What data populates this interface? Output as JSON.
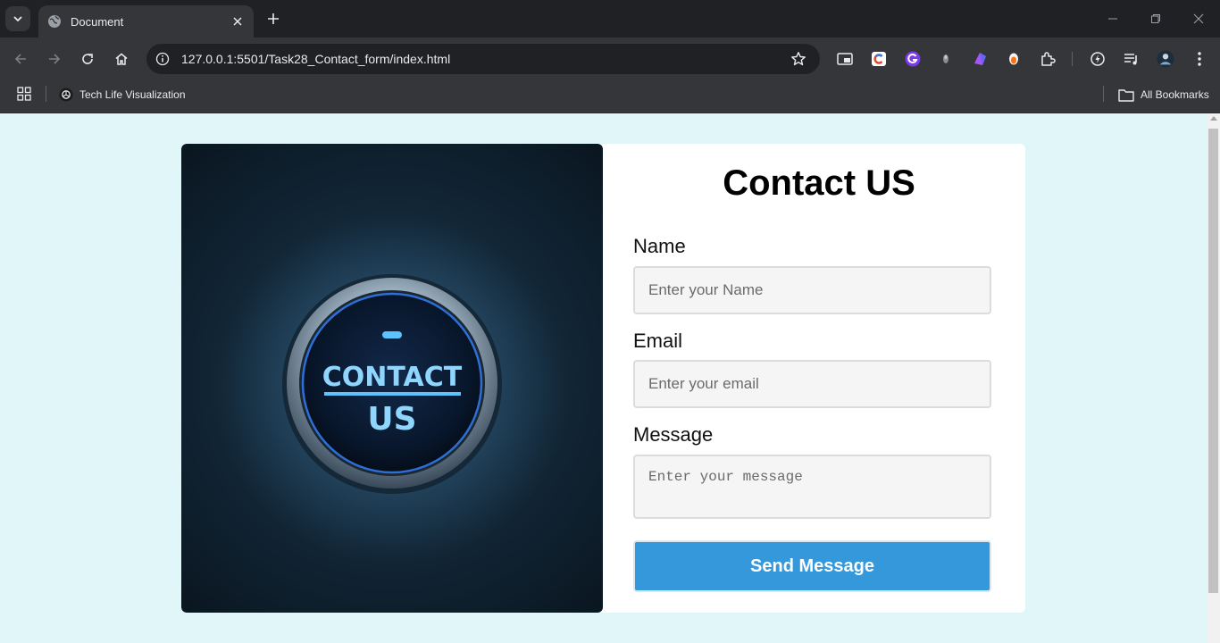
{
  "browser": {
    "tab_title": "Document",
    "url": "127.0.0.1:5501/Task28_Contact_form/index.html",
    "bookmarks": [
      {
        "label": "Tech Life Visualization",
        "icon": "openai-icon"
      }
    ],
    "all_bookmarks_label": "All Bookmarks"
  },
  "hero": {
    "button_line1": "CONTACT",
    "button_line2": "US",
    "glow_color": "#3aa8ff"
  },
  "form": {
    "title": "Contact US",
    "name_label": "Name",
    "name_placeholder": "Enter your Name",
    "email_label": "Email",
    "email_placeholder": "Enter your email",
    "message_label": "Message",
    "message_placeholder": "Enter your message",
    "submit_label": "Send Message"
  },
  "colors": {
    "page_background": "#e0f6f9",
    "button": "#3498db"
  }
}
